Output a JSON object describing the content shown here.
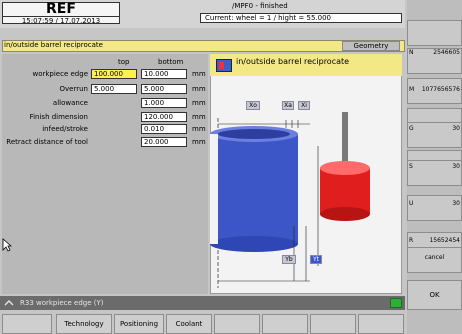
{
  "header": {
    "title": "REF",
    "datetime": "15:07:59 / 17.07.2013",
    "program": "/MPF0 - finished",
    "current": "Current:  wheel = 1   / hight = 55.000"
  },
  "dialog": {
    "title": "in/outside barrel reciprocate",
    "geometry_button": "Geometry"
  },
  "form": {
    "col_top": "top",
    "col_bottom": "bottom",
    "rows": [
      {
        "label": "workpiece edge",
        "top": "100.000",
        "bottom": "10.000",
        "unit": "mm"
      },
      {
        "label": "Overrun",
        "top": "5.000",
        "bottom": "5.000",
        "unit": "mm"
      },
      {
        "label": "allowance",
        "top": "",
        "bottom": "1.000",
        "unit": "mm"
      },
      {
        "label": "Finish dimension",
        "top": "",
        "bottom": "120.000",
        "unit": "mm"
      },
      {
        "label": "infeed/stroke",
        "top": "",
        "bottom": "0.010",
        "unit": "mm"
      },
      {
        "label": "Retract distance of tool",
        "top": "",
        "bottom": "20.000",
        "unit": "mm"
      }
    ]
  },
  "graphic": {
    "title": "in/outside barrel reciprocate",
    "dims": [
      "Xo",
      "Xa",
      "Xi",
      "Yb",
      "Yt"
    ]
  },
  "softkeys_right": [
    {
      "label": "N",
      "value": "2546605"
    },
    {
      "label": "M",
      "value": "1077656576"
    },
    {
      "label": "G",
      "value": "30"
    },
    {
      "label": "S",
      "value": "30"
    },
    {
      "label": "U",
      "value": "30"
    },
    {
      "label": "R",
      "value": "15652454"
    },
    {
      "label": "",
      "value": "cancel"
    },
    {
      "label": "",
      "value": "OK"
    }
  ],
  "status": {
    "text": "R33   workpiece edge (Y)"
  },
  "bottom_softkeys": [
    "",
    "Technology",
    "Positioning",
    "Coolant",
    "",
    "",
    "",
    ""
  ]
}
